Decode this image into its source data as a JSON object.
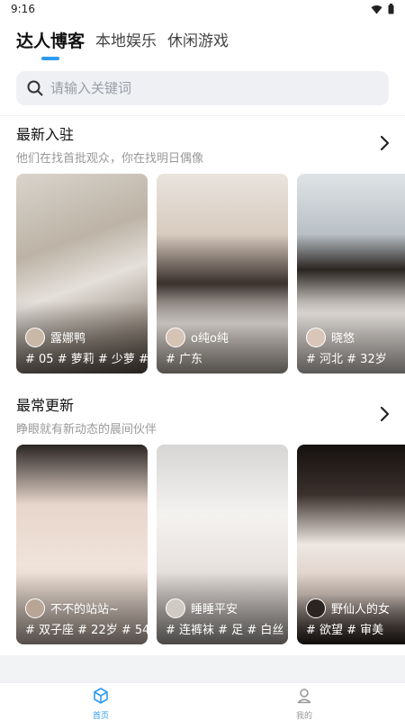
{
  "status_bar": {
    "time": "9:16"
  },
  "top_tabs": [
    {
      "label": "达人博客",
      "active": true
    },
    {
      "label": "本地娱乐",
      "active": false
    },
    {
      "label": "休闲游戏",
      "active": false
    }
  ],
  "search": {
    "placeholder": "请输入关键词"
  },
  "sections": [
    {
      "title": "最新入驻",
      "subtitle": "他们在找首批观众，你在找明日偶像",
      "cards": [
        {
          "name": "露娜鸭",
          "tags": "# 05  # 萝莉  # 少萝  #"
        },
        {
          "name": "o纯o纯",
          "tags": "# 广东"
        },
        {
          "name": "晓悠",
          "tags": "# 河北  # 32岁"
        }
      ]
    },
    {
      "title": "最常更新",
      "subtitle": "睁眼就有新动态的晨间伙伴",
      "cards": [
        {
          "name": "不不的站站~",
          "tags": "# 双子座  # 22岁  # 54"
        },
        {
          "name": "睡睡平安",
          "tags": "# 连裤袜  # 足  # 白丝"
        },
        {
          "name": "野仙人的女",
          "tags": "# 欲望  # 审美"
        }
      ]
    }
  ],
  "bottom_nav": [
    {
      "label": "首页",
      "icon": "home-cube-icon",
      "active": true
    },
    {
      "label": "我的",
      "icon": "profile-icon",
      "active": false
    }
  ],
  "colors": {
    "accent": "#2f9bf0",
    "search_bg": "#eef0f3"
  }
}
